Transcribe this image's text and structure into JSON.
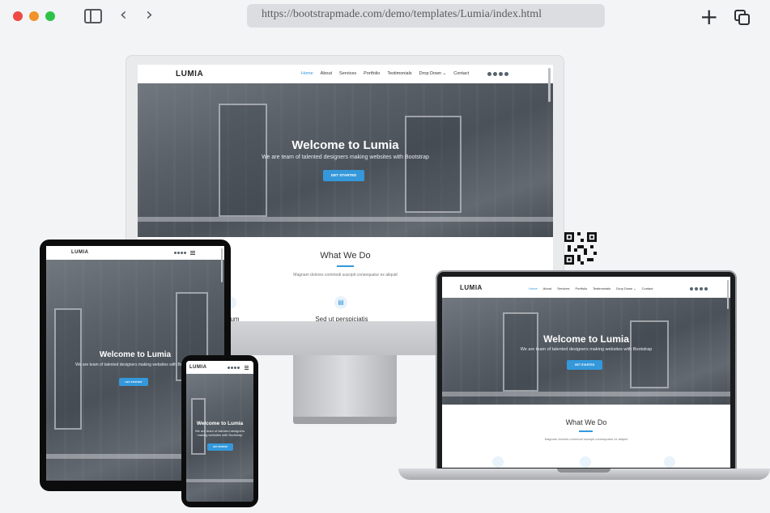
{
  "browser": {
    "url": "https://bootstrapmade.com/demo/templates/Lumia/index.html",
    "back_icon": "chevron-left-icon",
    "forward_icon": "chevron-right-icon",
    "new_tab_icon": "plus-icon",
    "tabs_icon": "tabs-overview-icon",
    "sidebar_icon": "sidebar-icon",
    "traffic_lights": [
      "#ee4a45",
      "#f0932b",
      "#2fc24a"
    ]
  },
  "site": {
    "logo": "LUMIA",
    "menu": [
      {
        "label": "Home",
        "active": true
      },
      {
        "label": "About"
      },
      {
        "label": "Services"
      },
      {
        "label": "Portfolio"
      },
      {
        "label": "Testimonials"
      },
      {
        "label": "Drop Down ⌄"
      },
      {
        "label": "Contact"
      }
    ],
    "hero_title": "Welcome to Lumia",
    "hero_subtitle": "We are team of talented designers making websites with Bootstrap",
    "cta": "GET STARTED",
    "section_title": "What We Do",
    "section_subtitle": "Magnam dolores commodi suscipit consequatur ex aliquid",
    "services": [
      "Lorem Ipsum",
      "Sed ut perspiciatis"
    ],
    "accent_color": "#3498db"
  },
  "imac_services_visible": [
    "psum",
    "Sed ut perspiciatis"
  ]
}
